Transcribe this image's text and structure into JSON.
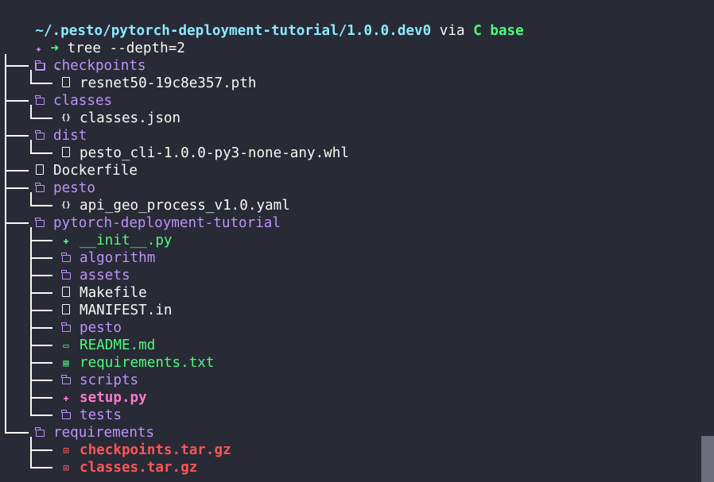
{
  "prompt": {
    "path": "~/.pesto/pytorch-deployment-tutorial/1.0.0.dev0",
    "via": " via ",
    "env_icon": "C",
    "env_name": " base",
    "sparkle": "✦",
    "arrow": "➜",
    "command": " tree --depth=2"
  },
  "root": {
    "icon": "folder-open-icon",
    "name": "."
  },
  "entries": [
    {
      "name": "checkpoints",
      "kind": "dir",
      "icon": "folder-icon"
    },
    {
      "name": "resnet50-19c8e357.pth",
      "kind": "file",
      "icon": "file-icon"
    },
    {
      "name": "classes",
      "kind": "dir",
      "icon": "folder-icon"
    },
    {
      "name": "classes.json",
      "kind": "json",
      "icon": "json-icon",
      "glyph": "{}"
    },
    {
      "name": "dist",
      "kind": "dir",
      "icon": "folder-icon"
    },
    {
      "name": "pesto_cli-1.0.0-py3-none-any.whl",
      "kind": "file",
      "icon": "file-icon"
    },
    {
      "name": "Dockerfile",
      "kind": "file",
      "icon": "file-icon"
    },
    {
      "name": "pesto",
      "kind": "dir",
      "icon": "folder-icon"
    },
    {
      "name": "api_geo_process_v1.0.yaml",
      "kind": "yaml",
      "icon": "yaml-icon",
      "glyph": "{}"
    },
    {
      "name": "pytorch-deployment-tutorial",
      "kind": "dir",
      "icon": "folder-icon"
    },
    {
      "name": "__init__.py",
      "kind": "py",
      "icon": "python-icon",
      "glyph": "✚"
    },
    {
      "name": "algorithm",
      "kind": "dir",
      "icon": "folder-icon"
    },
    {
      "name": "assets",
      "kind": "dir",
      "icon": "folder-icon"
    },
    {
      "name": "Makefile",
      "kind": "file",
      "icon": "file-icon"
    },
    {
      "name": "MANIFEST.in",
      "kind": "file",
      "icon": "file-icon"
    },
    {
      "name": "pesto",
      "kind": "dir",
      "icon": "folder-icon"
    },
    {
      "name": "README.md",
      "kind": "md",
      "icon": "markdown-icon",
      "glyph": "▭"
    },
    {
      "name": "requirements.txt",
      "kind": "txt",
      "icon": "text-file-icon",
      "glyph": "▤"
    },
    {
      "name": "scripts",
      "kind": "dir",
      "icon": "folder-icon"
    },
    {
      "name": "setup.py",
      "kind": "exec",
      "icon": "python-icon",
      "glyph": "✚"
    },
    {
      "name": "tests",
      "kind": "dir",
      "icon": "folder-icon"
    },
    {
      "name": "requirements",
      "kind": "dir",
      "icon": "folder-icon"
    },
    {
      "name": "checkpoints.tar.gz",
      "kind": "arch",
      "icon": "archive-icon",
      "glyph": "⊡"
    },
    {
      "name": "classes.tar.gz",
      "kind": "arch",
      "icon": "archive-icon",
      "glyph": "⊡"
    }
  ],
  "colors": {
    "background": "#282a36",
    "foreground": "#f8f8f2",
    "directory": "#bd93f9",
    "path": "#8be9fd",
    "green": "#50fa7b",
    "pink": "#ff79c6",
    "red": "#ff5555"
  }
}
